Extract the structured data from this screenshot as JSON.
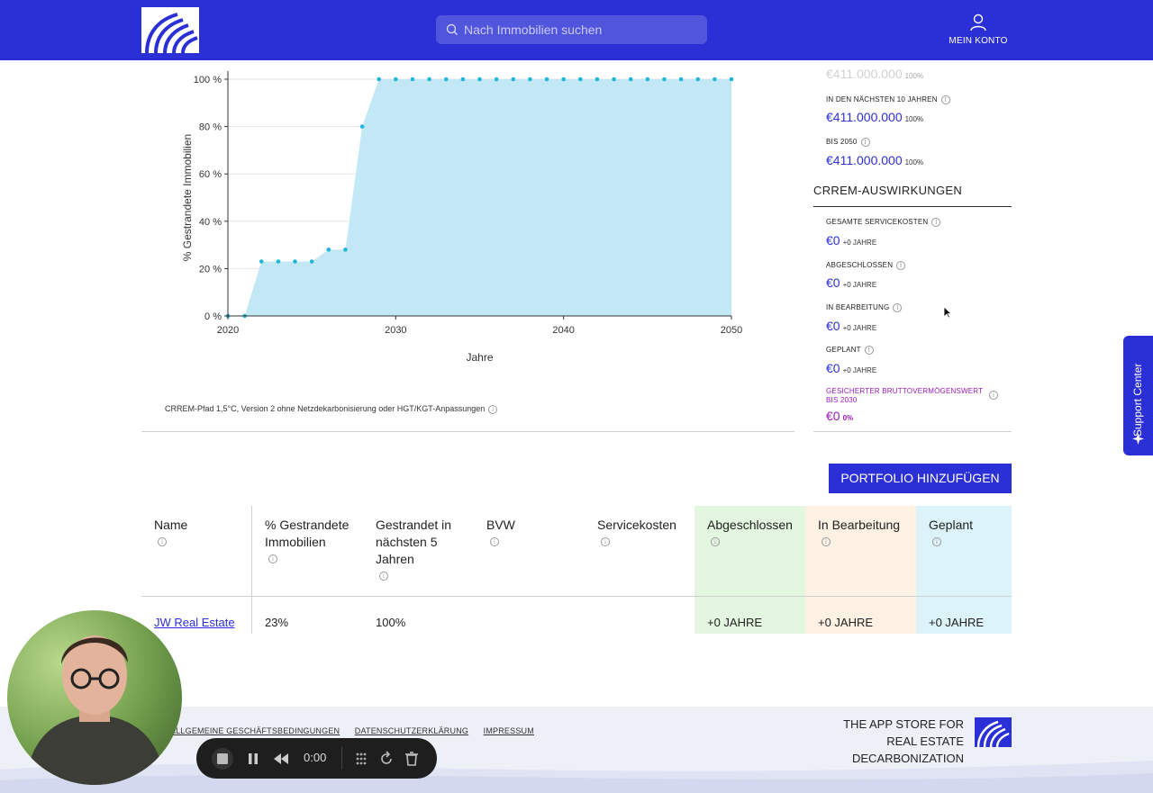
{
  "header": {
    "search_placeholder": "Nach Immobilien suchen",
    "account_label": "MEIN KONTO",
    "brand_color": "#2b2fd6"
  },
  "chart_data": {
    "type": "area",
    "x": [
      2020,
      2021,
      2022,
      2023,
      2024,
      2025,
      2026,
      2027,
      2028,
      2029,
      2030,
      2031,
      2032,
      2033,
      2034,
      2035,
      2036,
      2037,
      2038,
      2039,
      2040,
      2041,
      2042,
      2043,
      2044,
      2045,
      2046,
      2047,
      2048,
      2049,
      2050
    ],
    "series": [
      {
        "values": [
          0,
          0,
          23,
          23,
          23,
          23,
          28,
          28,
          80,
          100,
          100,
          100,
          100,
          100,
          100,
          100,
          100,
          100,
          100,
          100,
          100,
          100,
          100,
          100,
          100,
          100,
          100,
          100,
          100,
          100,
          100
        ]
      }
    ],
    "xlabel": "Jahre",
    "ylabel": "% Gestrandete Immobilien",
    "xlim": [
      2020,
      2050
    ],
    "ylim": [
      0,
      100
    ],
    "xticks": [
      "2020",
      "2030",
      "2040",
      "2050"
    ],
    "yticks": [
      "0 %",
      "20 %",
      "40 %",
      "60 %",
      "80 %",
      "100 %"
    ],
    "grid": true,
    "fill_color": "#c2e8f6",
    "point_color": "#1fb6d9"
  },
  "chart_caption": "CRREM-Pfad 1,5°C, Version 2 ohne Netzdekarbonisierung oder HGT/KGT-Anpassungen",
  "right_panel": {
    "cut_value": "€411.000.000",
    "cut_percent": "100%",
    "next10_label": "IN DEN NÄCHSTEN 10 JAHREN",
    "next10_value": "€411.000.000",
    "next10_percent": "100%",
    "by2050_label": "BIS 2050",
    "by2050_value": "€411.000.000",
    "by2050_percent": "100%",
    "crrem_heading": "CRREM-AUSWIRKUNGEN",
    "items": [
      {
        "label": "GESAMTE SERVICEKOSTEN",
        "value": "€0",
        "sub": "+0 JAHRE"
      },
      {
        "label": "ABGESCHLOSSEN",
        "value": "€0",
        "sub": "+0 JAHRE"
      },
      {
        "label": "IN BEARBEITUNG",
        "value": "€0",
        "sub": "+0 JAHRE"
      },
      {
        "label": "GEPLANT",
        "value": "€0",
        "sub": "+0 JAHRE"
      }
    ],
    "gbv_label": "GESICHERTER BRUTTOVERMÖGENSWERT BIS 2030",
    "gbv_value": "€0",
    "gbv_percent": "0%",
    "gbv_color": "#9a1ab8"
  },
  "portfolio_button": "PORTFOLIO HINZUFÜGEN",
  "table": {
    "columns": [
      {
        "header": "Name",
        "cell": "JW Real Estate"
      },
      {
        "header": "% Gestrandete Immobilien",
        "cell": "23%"
      },
      {
        "header": "Gestrandet in nächsten 5 Jahren",
        "cell": "100%"
      },
      {
        "header": "BVW",
        "cell": ""
      },
      {
        "header": "Servicekosten",
        "cell": ""
      },
      {
        "header": "Abgeschlossen",
        "cell": "+0 JAHRE"
      },
      {
        "header": "In Bearbeitung",
        "cell": "+0 JAHRE"
      },
      {
        "header": "Geplant",
        "cell": "+0 JAHRE"
      }
    ],
    "col_colors": [
      "#ffffff",
      "#ffffff",
      "#ffffff",
      "#ffffff",
      "#ffffff",
      "#e3f6df",
      "#fdf1e3",
      "#dcf3f9"
    ]
  },
  "support_label": "Support Center",
  "footer": {
    "links": [
      "ALLGEMEINE GESCHÄFTSBEDINGUNGEN",
      "DATENSCHUTZERKLÄRUNG",
      "IMPRESSUM"
    ],
    "tagline_line1": "THE APP STORE FOR",
    "tagline_line2": "REAL ESTATE DECARBONIZATION"
  },
  "recorder": {
    "time": "0:00"
  }
}
